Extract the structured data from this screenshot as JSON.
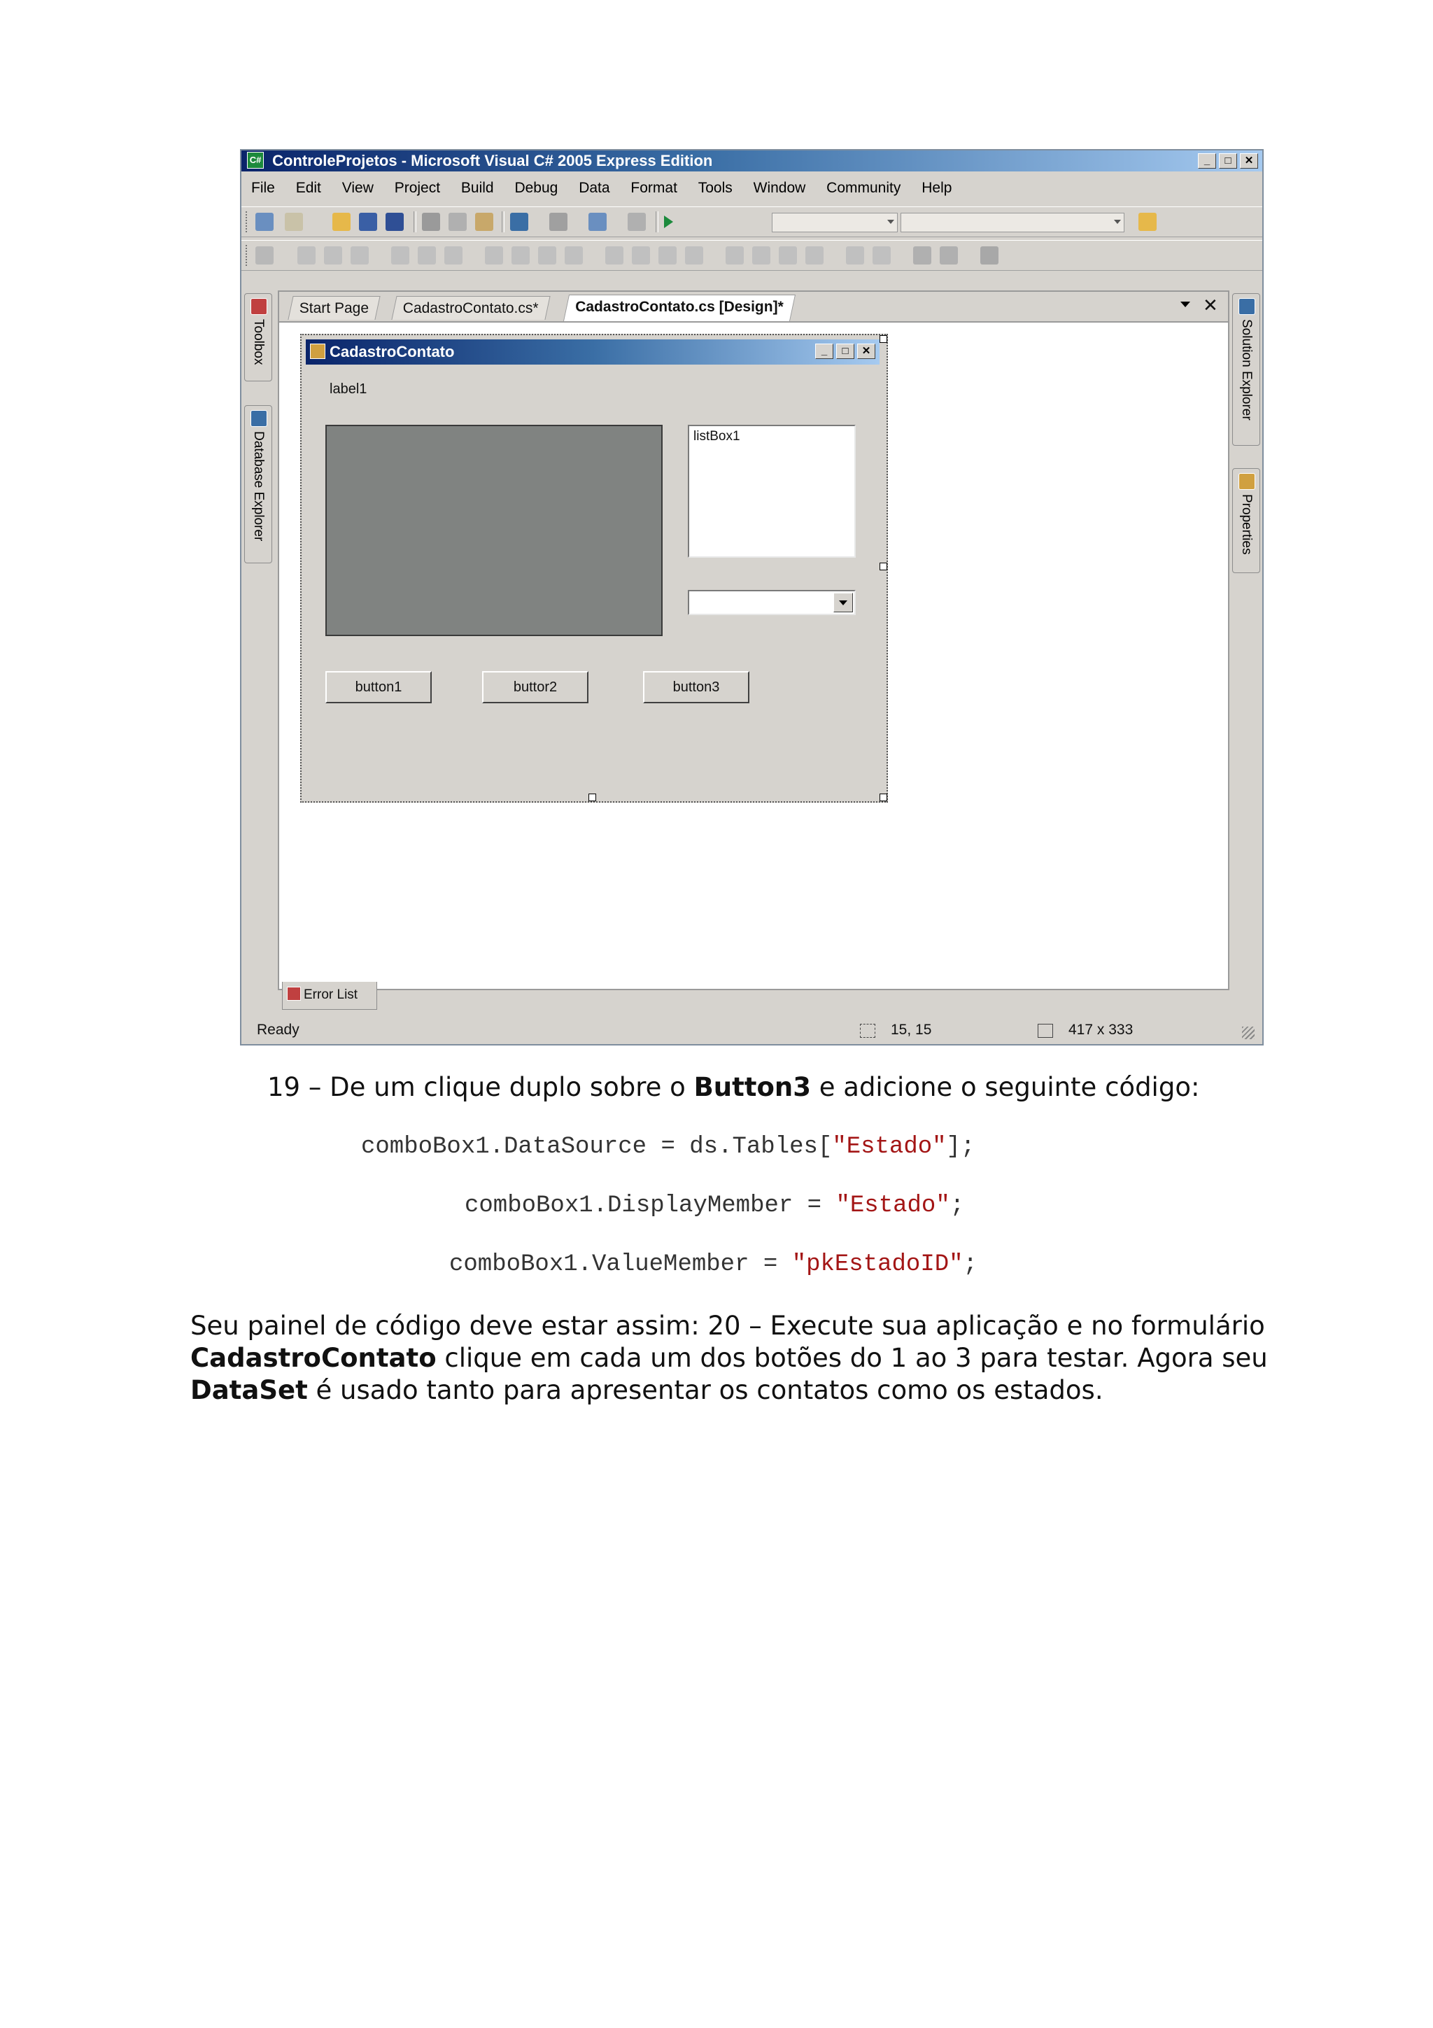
{
  "ide": {
    "title": "ControleProjetos - Microsoft Visual C# 2005 Express Edition",
    "menu": [
      "File",
      "Edit",
      "View",
      "Project",
      "Build",
      "Debug",
      "Data",
      "Format",
      "Tools",
      "Window",
      "Community",
      "Help"
    ],
    "left_panels": [
      "Toolbox",
      "Database Explorer"
    ],
    "right_panels": [
      "Solution Explorer",
      "Properties"
    ],
    "tabs": [
      "Start Page",
      "CadastroContato.cs*",
      "CadastroContato.cs [Design]*"
    ],
    "form": {
      "title": "CadastroContato",
      "label": "label1",
      "listbox": "listBox1",
      "buttons": [
        "button1",
        "buttor2",
        "button3"
      ]
    },
    "error_list": "Error List",
    "status": {
      "ready": "Ready",
      "position": "15, 15",
      "size": "417 x 333"
    }
  },
  "text": {
    "step19_prefix": "19 – De um clique duplo sobre o ",
    "step19_bold": "Button3",
    "step19_suffix": " e adicione o seguinte código:",
    "code": [
      {
        "before": "comboBox1.DataSource = ds.Tables[",
        "string": "\"Estado\"",
        "after": "];"
      },
      {
        "before": "comboBox1.DisplayMember = ",
        "string": "\"Estado\"",
        "after": ";"
      },
      {
        "before": "comboBox1.ValueMember = ",
        "string": "\"pkEstadoID\"",
        "after": ";"
      }
    ],
    "p1": "Seu painel de código deve estar assim: 20 – Execute sua aplicação e no formulário",
    "p2_bold": "CadastroContato",
    "p2_rest": " clique em cada um dos botões do 1 ao 3 para testar. Agora seu",
    "p3_bold": "DataSet",
    "p3_rest": " é usado tanto para apresentar os contatos como os estados."
  },
  "colors": {
    "title_gradient_start": "#0a246a",
    "title_gradient_end": "#a6caf0",
    "panel_gray": "#808381",
    "code_string": "#a31515"
  }
}
